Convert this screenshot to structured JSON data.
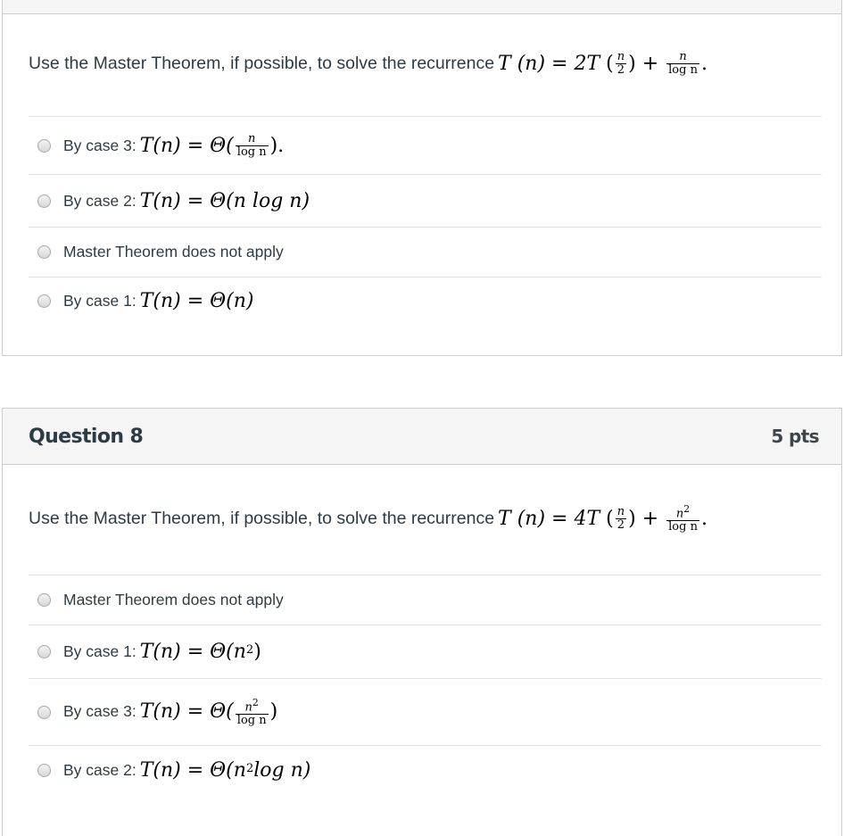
{
  "questions": [
    {
      "id": "q7",
      "title": "",
      "points": "",
      "prompt_text": "Use the Master Theorem, if possible, to solve the recurrence",
      "prompt_math": {
        "lhs": "T (n) = ",
        "coef": "2T",
        "sub_num": "n",
        "sub_den": "2",
        "plus": "+",
        "add_num": "n",
        "add_den": "log n",
        "end": "."
      },
      "answers": [
        {
          "prefix": "By case 3:",
          "math": "T(n) = Θ(",
          "frac_num": "n",
          "frac_den": "log n",
          "tail": ")."
        },
        {
          "prefix": "By case 2:",
          "math": "T(n) = Θ(n log n)"
        },
        {
          "prefix": "Master Theorem does not apply",
          "math": ""
        },
        {
          "prefix": "By case 1:",
          "math": "T(n) = Θ(n)"
        }
      ]
    },
    {
      "id": "q8",
      "title": "Question 8",
      "points": "5 pts",
      "prompt_text": "Use the Master Theorem, if possible, to solve the recurrence",
      "prompt_math": {
        "lhs": "T (n) = ",
        "coef": "4T",
        "sub_num": "n",
        "sub_den": "2",
        "plus": "+",
        "add_num": "n",
        "add_num_exp": "2",
        "add_den": "log n",
        "end": "."
      },
      "answers": [
        {
          "prefix": "Master Theorem does not apply",
          "math": ""
        },
        {
          "prefix": "By case 1:",
          "math": "T(n) = Θ(n",
          "exp": "2",
          "tail": ")"
        },
        {
          "prefix": "By case 3:",
          "math": "T(n) = Θ(",
          "frac_num": "n",
          "frac_num_exp": "2",
          "frac_den": "log n",
          "tail": ")"
        },
        {
          "prefix": "By case 2:",
          "math": "T(n) = Θ(n",
          "exp": "2",
          "tail": " log n)"
        }
      ]
    }
  ]
}
